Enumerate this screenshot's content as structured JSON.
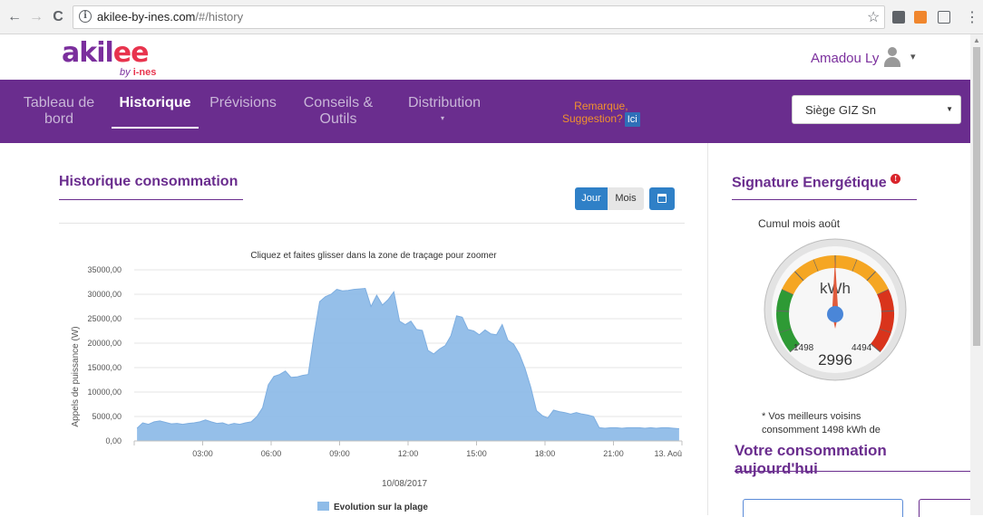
{
  "browser": {
    "url_domain": "akilee-by-ines.com",
    "url_path": "/#/history",
    "back_icon": "←",
    "forward_icon": "→",
    "reload_icon": "C",
    "info_icon": "i",
    "star_icon": "☆",
    "menu_icon": "⋮"
  },
  "header": {
    "logo_main": "akil",
    "logo_e": "ee",
    "logo_sub_by": "by ",
    "logo_sub_ines": "i-nes",
    "user_name": "Amadou Ly",
    "caret": "▾"
  },
  "nav": {
    "items": [
      {
        "label": "Tableau de bord"
      },
      {
        "label": "Historique"
      },
      {
        "label": "Prévisions"
      },
      {
        "label": "Conseils & Outils"
      },
      {
        "label": "Distribution"
      }
    ],
    "distribution_caret": "▾",
    "remark_line1": "Remarque,",
    "remark_line2": "Suggestion?",
    "ici": "Ici",
    "site_select": "Siège GIZ Sn",
    "site_caret": "▼"
  },
  "history": {
    "title": "Historique consommation",
    "jour": "Jour",
    "mois": "Mois"
  },
  "chart_data": {
    "type": "area",
    "title": "Cliquez et faites glisser dans la zone de traçage pour zoomer",
    "ylabel": "Appels de puissance (W)",
    "xlabel": "10/08/2017",
    "legend": "Evolution sur la plage",
    "legend_position": "bottom",
    "ylim": [
      0,
      35000
    ],
    "y_ticks": [
      "0,00",
      "5000,00",
      "10000,00",
      "15000,00",
      "20000,00",
      "25000,00",
      "30000,00",
      "35000,00"
    ],
    "x_ticks": [
      {
        "hour": 3,
        "label": "03:00"
      },
      {
        "hour": 6,
        "label": "06:00"
      },
      {
        "hour": 9,
        "label": "09:00"
      },
      {
        "hour": 12,
        "label": "12:00"
      },
      {
        "hour": 15,
        "label": "15:00"
      },
      {
        "hour": 18,
        "label": "18:00"
      },
      {
        "hour": 21,
        "label": "21:00"
      },
      {
        "hour": 24,
        "label": "13. Aoû"
      }
    ],
    "x_range_hours": [
      0,
      24
    ],
    "color": "#8fbce8",
    "series": [
      {
        "x": [
          0.0,
          0.25,
          0.5,
          0.75,
          1.0,
          1.25,
          1.5,
          1.75,
          2.0,
          2.25,
          2.5,
          2.75,
          3.0,
          3.25,
          3.5,
          3.75,
          4.0,
          4.25,
          4.5,
          4.75,
          5.0,
          5.25,
          5.5,
          5.75,
          6.0,
          6.25,
          6.5,
          6.75,
          7.0,
          7.25,
          7.5,
          7.75,
          8.0,
          8.25,
          8.5,
          8.75,
          9.0,
          9.25,
          9.5,
          9.75,
          10.0,
          10.25,
          10.5,
          10.75,
          11.0,
          11.25,
          11.5,
          11.75,
          12.0,
          12.25,
          12.5,
          12.75,
          13.0,
          13.25,
          13.5,
          13.75,
          14.0,
          14.25,
          14.5,
          14.75,
          15.0,
          15.25,
          15.5,
          15.75,
          16.0,
          16.25,
          16.5,
          16.75,
          17.0,
          17.25,
          17.5,
          17.75,
          18.0,
          18.25,
          18.5,
          18.75,
          19.0,
          19.25,
          19.5,
          19.75,
          20.0,
          20.25,
          20.5,
          20.75,
          21.0,
          21.25,
          21.5,
          21.75,
          22.0,
          22.25,
          22.5,
          22.75,
          23.0,
          23.25,
          23.5,
          23.75
        ],
        "y": [
          2600,
          3700,
          3400,
          3900,
          4100,
          3800,
          3500,
          3600,
          3400,
          3600,
          3700,
          3900,
          4300,
          3900,
          3600,
          3700,
          3300,
          3600,
          3400,
          3700,
          3900,
          5000,
          6800,
          11500,
          13200,
          13600,
          14300,
          13000,
          13100,
          13400,
          13600,
          21500,
          28500,
          29500,
          30000,
          31000,
          30700,
          30800,
          31000,
          31100,
          31200,
          27500,
          29800,
          27800,
          28900,
          30500,
          24500,
          23800,
          24500,
          22800,
          22600,
          18500,
          17800,
          18800,
          19500,
          21500,
          25600,
          25300,
          22800,
          22500,
          21700,
          22700,
          21900,
          21700,
          23800,
          20600,
          19800,
          17800,
          14800,
          11000,
          6200,
          5200,
          4700,
          6300,
          6000,
          5800,
          5500,
          5800,
          5500,
          5300,
          5000,
          2700,
          2600,
          2700,
          2700,
          2600,
          2700,
          2700,
          2700,
          2600,
          2700,
          2600,
          2700,
          2700,
          2600,
          2500
        ]
      }
    ]
  },
  "signature": {
    "title": "Signature Energétique",
    "info": "!",
    "cumul": "Cumul mois août",
    "gauge_unit": "kWh",
    "gauge_min": "1498",
    "gauge_max": "4494",
    "gauge_value": "2996",
    "gauge_value_num": 2996,
    "gauge_range": [
      0,
      6000
    ],
    "note_line1": "* Vos meilleurs voisins",
    "note_line2": "consomment 1498 kWh de"
  },
  "today": {
    "title": "Votre consommation aujourd'hui"
  },
  "colors": {
    "purple": "#6a2d8e",
    "accent_red": "#e8344e",
    "blue": "#2f80c7",
    "gauge_green": "#2e9a35",
    "gauge_orange": "#f5a623",
    "gauge_red": "#d9341c"
  }
}
